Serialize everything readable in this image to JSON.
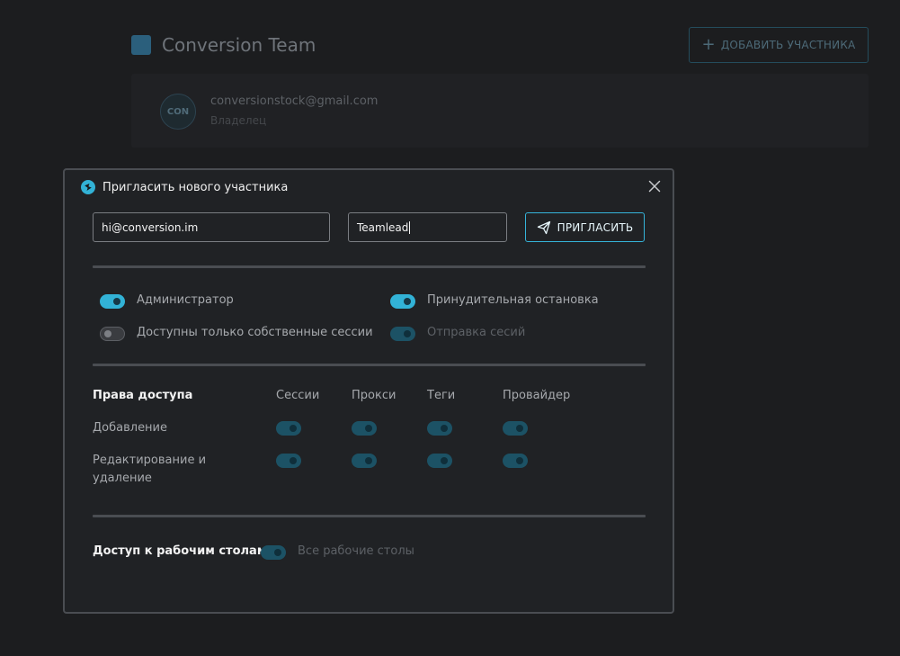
{
  "background": {
    "team_name": "Conversion Team",
    "add_member_label": "ДОБАВИТЬ УЧАСТНИКА",
    "member": {
      "avatar": "CON",
      "email": "conversionstock@gmail.com",
      "role": "Владелец"
    }
  },
  "modal": {
    "title": "Пригласить нового участника",
    "email_value": "hi@conversion.im",
    "role_value": "Teamlead",
    "invite_label": "ПРИГЛАСИТЬ",
    "options": {
      "admin": {
        "label": "Администратор",
        "state": "on"
      },
      "force_stop": {
        "label": "Принудительная остановка",
        "state": "on"
      },
      "own_sessions": {
        "label": "Доступны только собственные сессии",
        "state": "off"
      },
      "send_sessions": {
        "label": "Отправка сесий",
        "state": "disabled-on"
      }
    },
    "permissions": {
      "title": "Права доступа",
      "columns": [
        "Сессии",
        "Прокси",
        "Теги",
        "Провайдер"
      ],
      "rows": [
        {
          "label": "Добавление",
          "values": [
            "disabled-on",
            "disabled-on",
            "disabled-on",
            "disabled-on"
          ]
        },
        {
          "label": "Редактирование и удаление",
          "values": [
            "disabled-on",
            "disabled-on",
            "disabled-on",
            "disabled-on"
          ]
        }
      ]
    },
    "desktops": {
      "title": "Доступ к рабочим столам",
      "label": "Все рабочие столы",
      "state": "disabled-on"
    }
  },
  "colors": {
    "accent": "#32b2d6",
    "accent_dim": "#1c5265",
    "modal_bg": "#202225",
    "page_bg": "#1c1d1f"
  },
  "icons": [
    "plus-icon",
    "logo-icon",
    "close-icon",
    "send-icon"
  ]
}
